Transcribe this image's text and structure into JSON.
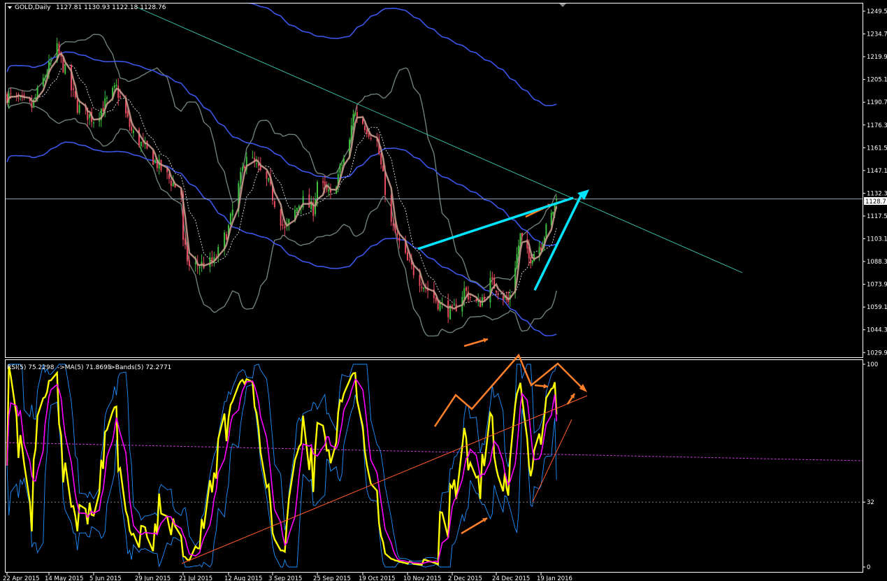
{
  "header": {
    "symbol_label": "GOLD,Daily",
    "ohlc": "1127.81 1130.93 1122.18 1128.76"
  },
  "rsi_header": {
    "rsi": "RSI(5) 75.2298",
    "ma": "->MA(5) 71.8695",
    "bands": "->Bands(5) 72.2771"
  },
  "price_axis": {
    "ticks": [
      "1249.5",
      "1234.7",
      "1219.9",
      "1205.1",
      "1190.7",
      "1176.3",
      "1161.5",
      "1147.1",
      "1132.3",
      "1117.5",
      "1103.1",
      "1088.3",
      "1073.9",
      "1059.1",
      "1044.3",
      "1029.9"
    ],
    "current_price_label": "1128.7"
  },
  "rsi_axis": {
    "ticks": [
      "100",
      "32",
      "0"
    ]
  },
  "date_axis": {
    "labels": [
      "22 Apr 2015",
      "14 May 2015",
      "5 Jun 2015",
      "29 Jun 2015",
      "21 Jul 2015",
      "12 Aug 2015",
      "3 Sep 2015",
      "25 Sep 2015",
      "19 Oct 2015",
      "10 Nov 2015",
      "2 Dec 2015",
      "24 Dec 2015",
      "19 Jan 2016"
    ]
  },
  "chart_data": [
    {
      "type": "candlestick",
      "panel": "price",
      "symbol": "GOLD",
      "timeframe": "Daily",
      "last": {
        "open": 1127.81,
        "high": 1130.93,
        "low": 1122.18,
        "close": 1128.76
      },
      "ylim": [
        1029.9,
        1249.5
      ],
      "x_start": "22 Apr 2015",
      "x_end": "19 Jan 2016",
      "close_anchors": [
        {
          "date": "22 Apr 2015",
          "close": 1195
        },
        {
          "date": "5 May 2015",
          "close": 1188
        },
        {
          "date": "18 May 2015",
          "close": 1225
        },
        {
          "date": "28 May 2015",
          "close": 1188
        },
        {
          "date": "5 Jun 2015",
          "close": 1180
        },
        {
          "date": "17 Jun 2015",
          "close": 1200
        },
        {
          "date": "25 Jun 2015",
          "close": 1172
        },
        {
          "date": "20 Jul 2015",
          "close": 1132
        },
        {
          "date": "21 Jul 2015",
          "close": 1100
        },
        {
          "date": "24 Jul 2015",
          "close": 1085
        },
        {
          "date": "5 Aug 2015",
          "close": 1088
        },
        {
          "date": "12 Aug 2015",
          "close": 1110
        },
        {
          "date": "21 Aug 2015",
          "close": 1158
        },
        {
          "date": "1 Sep 2015",
          "close": 1138
        },
        {
          "date": "9 Sep 2015",
          "close": 1108
        },
        {
          "date": "17 Sep 2015",
          "close": 1128
        },
        {
          "date": "23 Sep 2015",
          "close": 1122
        },
        {
          "date": "25 Sep 2015",
          "close": 1140
        },
        {
          "date": "2 Oct 2015",
          "close": 1130
        },
        {
          "date": "12 Oct 2015",
          "close": 1165
        },
        {
          "date": "14 Oct 2015",
          "close": 1185
        },
        {
          "date": "19 Oct 2015",
          "close": 1178
        },
        {
          "date": "26 Oct 2015",
          "close": 1165
        },
        {
          "date": "2 Nov 2015",
          "close": 1112
        },
        {
          "date": "10 Nov 2015",
          "close": 1088
        },
        {
          "date": "17 Nov 2015",
          "close": 1075
        },
        {
          "date": "25 Nov 2015",
          "close": 1062
        },
        {
          "date": "2 Dec 2015",
          "close": 1055
        },
        {
          "date": "8 Dec 2015",
          "close": 1070
        },
        {
          "date": "15 Dec 2015",
          "close": 1060
        },
        {
          "date": "21 Dec 2015",
          "close": 1075
        },
        {
          "date": "24 Dec 2015",
          "close": 1072
        },
        {
          "date": "31 Dec 2015",
          "close": 1062
        },
        {
          "date": "7 Jan 2016",
          "close": 1105
        },
        {
          "date": "12 Jan 2016",
          "close": 1090
        },
        {
          "date": "19 Jan 2016",
          "close": 1100
        },
        {
          "date": "25 Jan 2016",
          "close": 1118
        },
        {
          "date": "28 Jan 2016",
          "close": 1128.76
        }
      ],
      "horizontal_line": 1128.7,
      "bullish_color": "#3ec03e",
      "bearish_color": "#e84a5f"
    },
    {
      "type": "line",
      "panel": "rsi",
      "ylim": [
        0,
        100
      ],
      "levels": [
        32
      ],
      "series": [
        {
          "name": "RSI(5)",
          "last": 75.2298,
          "color": "#ffff00"
        },
        {
          "name": "MA(5)",
          "last": 71.8695,
          "color": "#ff00ff"
        },
        {
          "name": "Bands(5)",
          "last": 72.2771,
          "color": "#1e90ff"
        }
      ]
    }
  ],
  "colors": {
    "background": "#000000",
    "frame": "#ffffff",
    "trendline_cyan": "#00e5ff",
    "annotation_orange": "#ff7f2a",
    "ma_blue": "#3b55e6",
    "bollinger_gray": "#6e8075",
    "signal_line": "#c49a8c"
  }
}
